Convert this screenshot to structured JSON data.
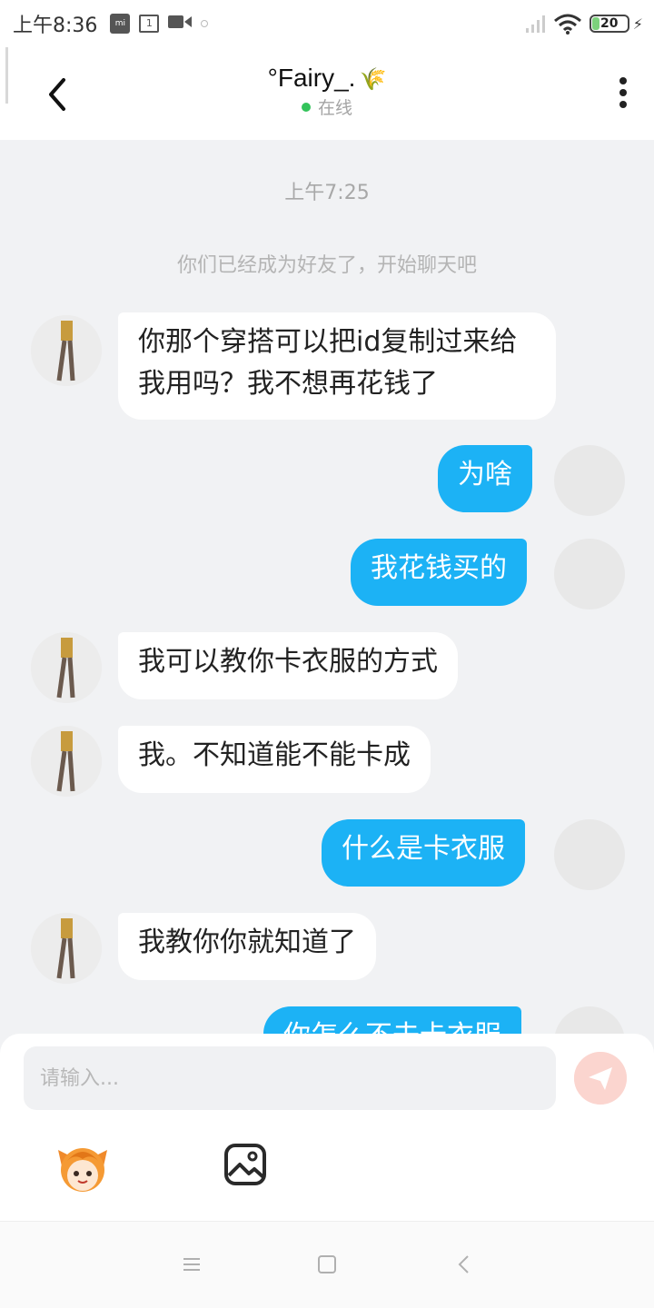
{
  "status_bar": {
    "time": "上午8:36",
    "battery": "20",
    "icons": [
      "mi-icon",
      "calendar-icon",
      "video-icon",
      "dot-icon",
      "signal-icon",
      "wifi-icon",
      "battery-icon",
      "charging-icon"
    ],
    "calendar_day": "1"
  },
  "header": {
    "contact_name": "°Fairy_.",
    "name_emoji": "🌾",
    "status": "在线",
    "status_color": "#33c35a"
  },
  "chat": {
    "timestamp": "上午7:25",
    "system_message": "你们已经成为好友了，开始聊天吧",
    "messages": [
      {
        "from": "them",
        "lines": [
          "你那个穿搭可以把id复制过来给",
          "我用吗？我不想再花钱了"
        ]
      },
      {
        "from": "me",
        "lines": [
          "为啥"
        ]
      },
      {
        "from": "me",
        "lines": [
          "我花钱买的"
        ]
      },
      {
        "from": "them",
        "lines": [
          "我可以教你卡衣服的方式"
        ]
      },
      {
        "from": "them",
        "lines": [
          "我。不知道能不能卡成"
        ]
      },
      {
        "from": "me",
        "lines": [
          "什么是卡衣服"
        ]
      },
      {
        "from": "them",
        "lines": [
          "我教你你就知道了"
        ]
      },
      {
        "from": "me",
        "lines": [
          "你怎么不去卡衣服"
        ]
      }
    ],
    "bubble_out_color": "#1cb2f5",
    "bubble_in_color": "#ffffff"
  },
  "input": {
    "placeholder": "请输入...",
    "value": "",
    "send_icon": "send-icon",
    "tools": [
      "emoji-icon",
      "image-icon"
    ]
  },
  "nav": {
    "buttons": [
      "menu-icon",
      "home-icon",
      "back-icon"
    ]
  }
}
